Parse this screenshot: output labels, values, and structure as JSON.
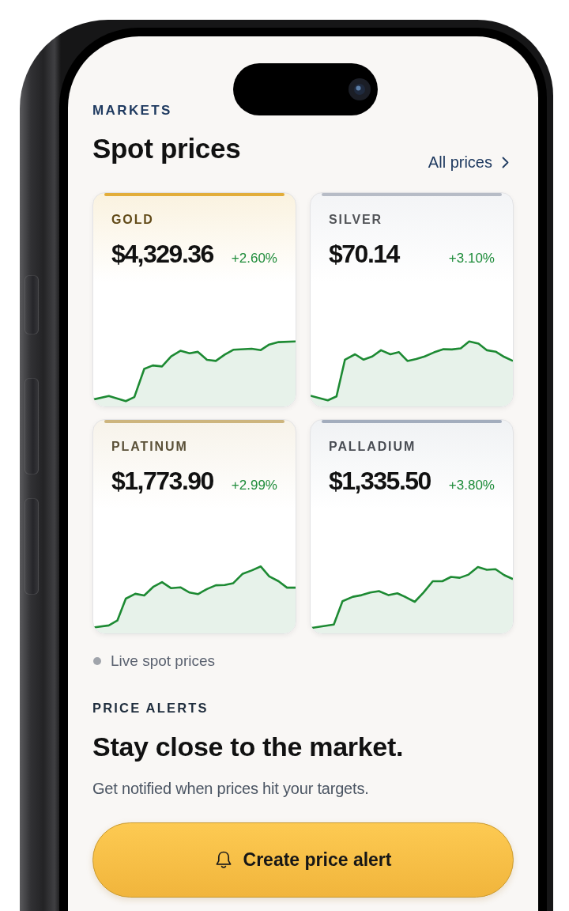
{
  "header": {
    "eyebrow": "MARKETS",
    "title": "Spot prices",
    "link": "All prices"
  },
  "metals": [
    {
      "name": "GOLD",
      "price": "$4,329.36",
      "change": "+2.60%",
      "color": "#e2ad3a"
    },
    {
      "name": "SILVER",
      "price": "$70.14",
      "change": "+3.10%",
      "color": "#b7bcc6"
    },
    {
      "name": "PLATINUM",
      "price": "$1,773.90",
      "change": "+2.99%",
      "color": "#cdb57e"
    },
    {
      "name": "PALLADIUM",
      "price": "$1,335.50",
      "change": "+3.80%",
      "color": "#a3adbd"
    }
  ],
  "legend": {
    "label": "Live spot prices"
  },
  "alerts": {
    "eyebrow": "PRICE ALERTS",
    "headline": "Stay close to the market.",
    "subtitle": "Get notified when prices hit your targets.",
    "button": "Create price alert"
  }
}
